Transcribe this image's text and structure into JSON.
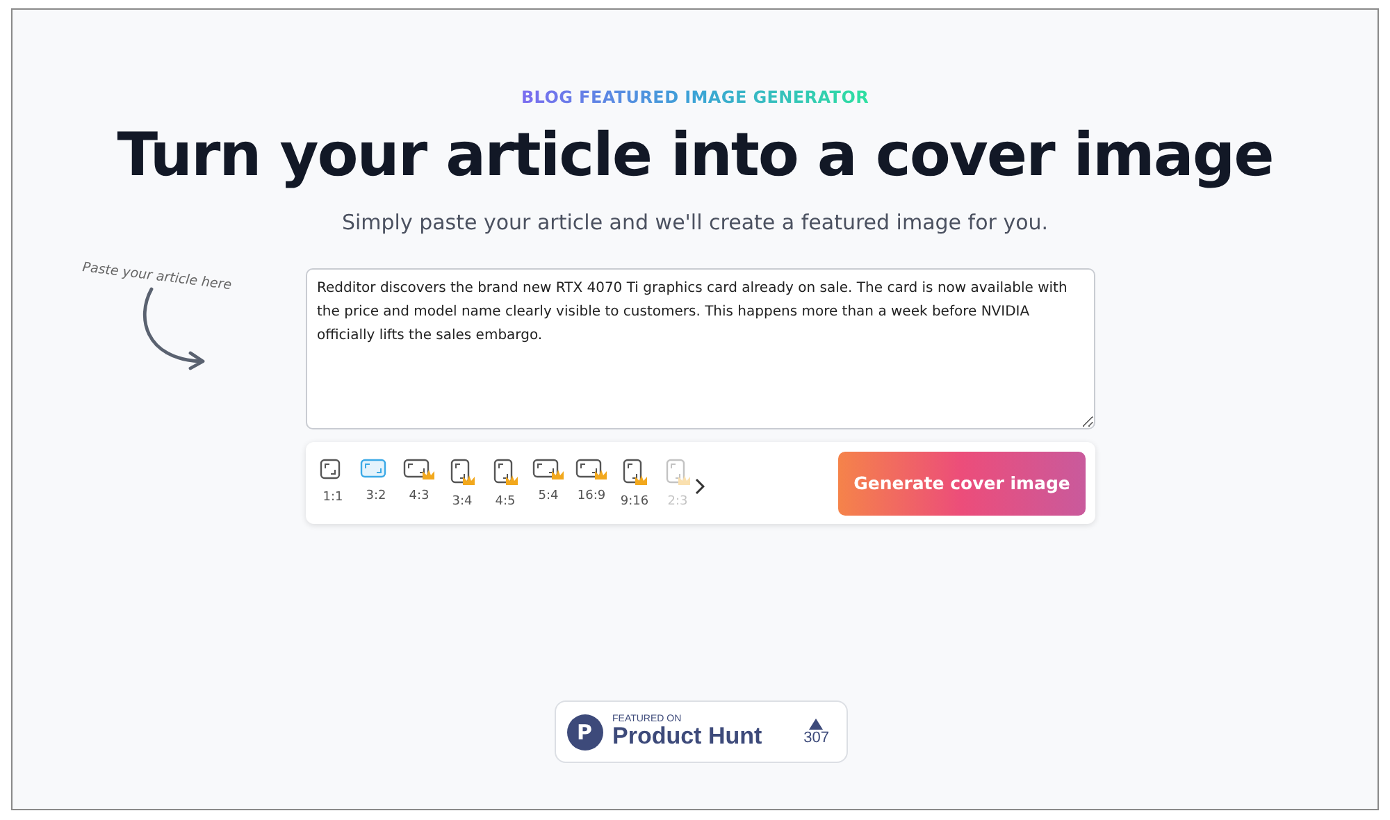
{
  "eyebrow": "BLOG FEATURED IMAGE GENERATOR",
  "title": "Turn your article into a cover image",
  "subtitle": "Simply paste your article and we'll create a featured image for you.",
  "hint": "Paste your article here",
  "article": {
    "value": "Redditor discovers the brand new RTX 4070 Ti graphics card already on sale. The card is now available with the price and model name clearly visible to customers. This happens more than a week before NVIDIA officially lifts the sales embargo."
  },
  "ratios": [
    {
      "label": "1:1",
      "kind": "square",
      "premium": false,
      "selected": false,
      "faded": false
    },
    {
      "label": "3:2",
      "kind": "landscape",
      "premium": false,
      "selected": true,
      "faded": false
    },
    {
      "label": "4:3",
      "kind": "landscape",
      "premium": true,
      "selected": false,
      "faded": false
    },
    {
      "label": "3:4",
      "kind": "portrait",
      "premium": true,
      "selected": false,
      "faded": false
    },
    {
      "label": "4:5",
      "kind": "portrait",
      "premium": true,
      "selected": false,
      "faded": false
    },
    {
      "label": "5:4",
      "kind": "landscape",
      "premium": true,
      "selected": false,
      "faded": false
    },
    {
      "label": "16:9",
      "kind": "landscape",
      "premium": true,
      "selected": false,
      "faded": false
    },
    {
      "label": "9:16",
      "kind": "portrait",
      "premium": true,
      "selected": false,
      "faded": false
    },
    {
      "label": "2:3",
      "kind": "portrait",
      "premium": true,
      "selected": false,
      "faded": true
    }
  ],
  "generate_button": "Generate cover image",
  "badge": {
    "overline": "FEATURED ON",
    "name": "Product Hunt",
    "letter": "P",
    "votes": "307"
  }
}
